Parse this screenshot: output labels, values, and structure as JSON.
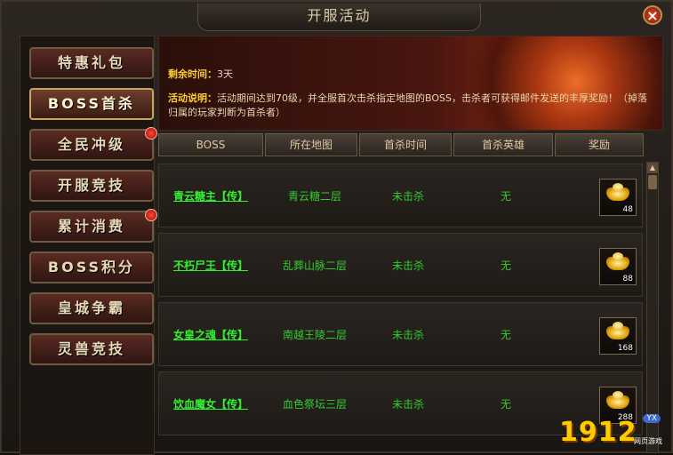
{
  "window": {
    "title": "开服活动"
  },
  "sidebar": {
    "items": [
      {
        "label": "特惠礼包",
        "badge": false,
        "active": false
      },
      {
        "label": "BOSS首杀",
        "badge": false,
        "active": true
      },
      {
        "label": "全民冲级",
        "badge": true,
        "active": false
      },
      {
        "label": "开服竞技",
        "badge": false,
        "active": false
      },
      {
        "label": "累计消费",
        "badge": true,
        "active": false
      },
      {
        "label": "BOSS积分",
        "badge": false,
        "active": false
      },
      {
        "label": "皇城争霸",
        "badge": false,
        "active": false
      },
      {
        "label": "灵兽竞技",
        "badge": false,
        "active": false
      }
    ]
  },
  "banner": {
    "remaining_label": "剩余时间：",
    "remaining_value": "3天",
    "desc_label": "活动说明：",
    "desc_text": "活动期间达到70级，并全服首次击杀指定地图的BOSS，击杀者可获得邮件发送的丰厚奖励！（掉落归属的玩家判断为首杀者）"
  },
  "table": {
    "headers": [
      "BOSS",
      "所在地图",
      "首杀时间",
      "首杀英雄",
      "奖励"
    ],
    "rows": [
      {
        "boss": "青云糖主【传】",
        "map": "青云糖二层",
        "time": "未击杀",
        "hero": "无",
        "reward_qty": "48"
      },
      {
        "boss": "不朽尸王【传】",
        "map": "乱葬山脉二层",
        "time": "未击杀",
        "hero": "无",
        "reward_qty": "88"
      },
      {
        "boss": "女皇之魂【传】",
        "map": "南越王陵二层",
        "time": "未击杀",
        "hero": "无",
        "reward_qty": "168"
      },
      {
        "boss": "饮血魔女【传】",
        "map": "血色祭坛三层",
        "time": "未击杀",
        "hero": "无",
        "reward_qty": "288"
      }
    ]
  },
  "watermark": {
    "number": "1912",
    "tag": "YX",
    "sub": "网页游戏"
  },
  "colors": {
    "accent_gold": "#ffcc33",
    "green_text": "#33cc33",
    "badge_red": "#e0251a"
  }
}
